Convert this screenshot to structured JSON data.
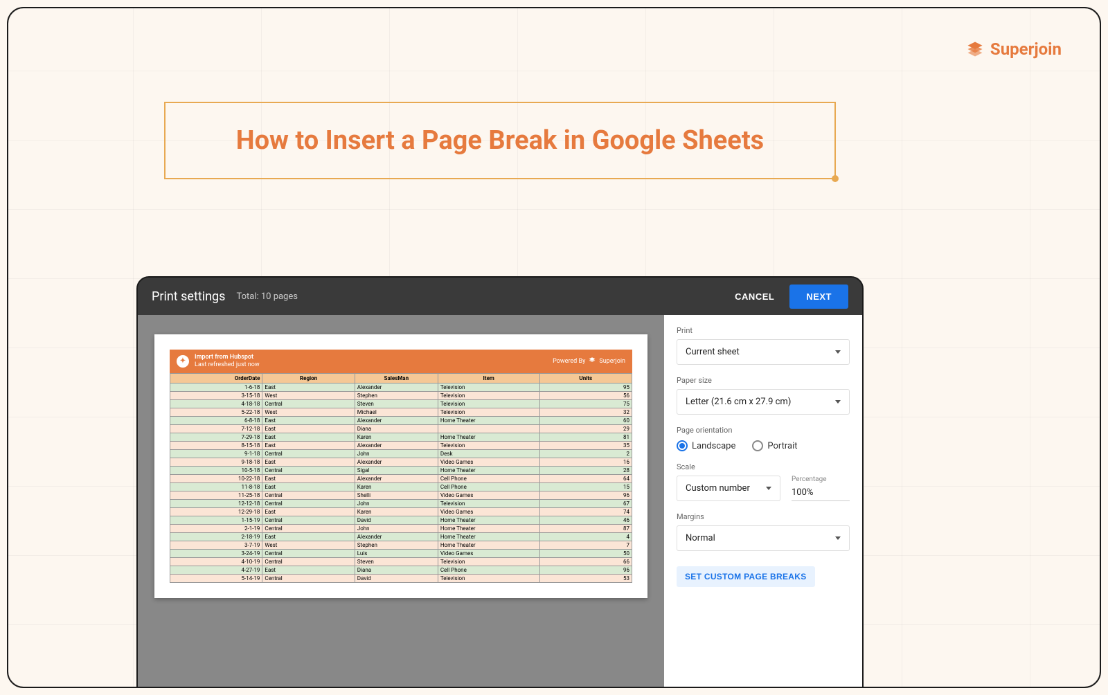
{
  "brand": {
    "name": "Superjoin"
  },
  "title": "How to Insert a Page Break in Google Sheets",
  "screenshot": {
    "header": {
      "title": "Print settings",
      "subtitle": "Total: 10 pages",
      "cancel": "CANCEL",
      "next": "NEXT"
    },
    "banner": {
      "line1": "Import from Hubspot",
      "line2": "Last refreshed just now",
      "powered_label": "Powered By",
      "powered_brand": "Superjoin"
    },
    "table": {
      "headers": [
        "OrderDate",
        "Region",
        "SalesMan",
        "Item",
        "Units"
      ],
      "rows": [
        [
          "1-6-18",
          "East",
          "Alexander",
          "Television",
          "95"
        ],
        [
          "3-15-18",
          "West",
          "Stephen",
          "Television",
          "56"
        ],
        [
          "4-18-18",
          "Central",
          "Steven",
          "Television",
          "75"
        ],
        [
          "5-22-18",
          "West",
          "Michael",
          "Television",
          "32"
        ],
        [
          "6-8-18",
          "East",
          "Alexander",
          "Home Theater",
          "60"
        ],
        [
          "7-12-18",
          "East",
          "Diana",
          "",
          "29"
        ],
        [
          "7-29-18",
          "East",
          "Karen",
          "Home Theater",
          "81"
        ],
        [
          "8-15-18",
          "East",
          "Alexander",
          "Television",
          "35"
        ],
        [
          "9-1-18",
          "Central",
          "John",
          "Desk",
          "2"
        ],
        [
          "9-18-18",
          "East",
          "Alexander",
          "Video Games",
          "16"
        ],
        [
          "10-5-18",
          "Central",
          "Sigal",
          "Home Theater",
          "28"
        ],
        [
          "10-22-18",
          "East",
          "Alexander",
          "Cell Phone",
          "64"
        ],
        [
          "11-8-18",
          "East",
          "Karen",
          "Cell Phone",
          "15"
        ],
        [
          "11-25-18",
          "Central",
          "Shelli",
          "Video Games",
          "96"
        ],
        [
          "12-12-18",
          "Central",
          "John",
          "Television",
          "67"
        ],
        [
          "12-29-18",
          "East",
          "Karen",
          "Video Games",
          "74"
        ],
        [
          "1-15-19",
          "Central",
          "David",
          "Home Theater",
          "46"
        ],
        [
          "2-1-19",
          "Central",
          "John",
          "Home Theater",
          "87"
        ],
        [
          "2-18-19",
          "East",
          "Alexander",
          "Home Theater",
          "4"
        ],
        [
          "3-7-19",
          "West",
          "Stephen",
          "Home Theater",
          "7"
        ],
        [
          "3-24-19",
          "Central",
          "Luis",
          "Video Games",
          "50"
        ],
        [
          "4-10-19",
          "Central",
          "Steven",
          "Television",
          "66"
        ],
        [
          "4-27-19",
          "East",
          "Diana",
          "Cell Phone",
          "96"
        ],
        [
          "5-14-19",
          "Central",
          "David",
          "Television",
          "53"
        ]
      ]
    },
    "sidebar": {
      "print_label": "Print",
      "print_value": "Current sheet",
      "paper_label": "Paper size",
      "paper_value": "Letter (21.6 cm x 27.9 cm)",
      "orientation_label": "Page orientation",
      "orientation_landscape": "Landscape",
      "orientation_portrait": "Portrait",
      "scale_label": "Scale",
      "scale_value": "Custom number",
      "percentage_label": "Percentage",
      "percentage_value": "100%",
      "margins_label": "Margins",
      "margins_value": "Normal",
      "custom_breaks": "SET CUSTOM PAGE BREAKS"
    }
  }
}
